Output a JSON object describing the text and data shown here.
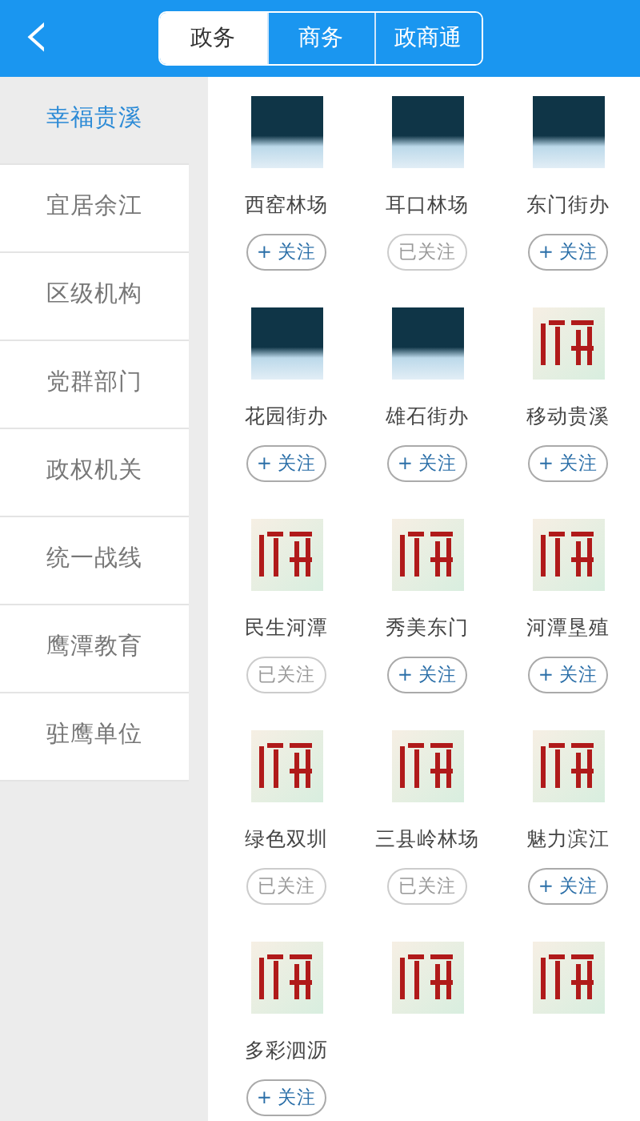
{
  "header": {
    "back_icon": "‹",
    "tabs": [
      {
        "label": "政务",
        "selected": true
      },
      {
        "label": "商务",
        "selected": false
      },
      {
        "label": "政商通",
        "selected": false
      }
    ]
  },
  "sidebar": {
    "items": [
      {
        "label": "幸福贵溪",
        "selected": true
      },
      {
        "label": "宜居余江",
        "selected": false
      },
      {
        "label": "区级机构",
        "selected": false
      },
      {
        "label": "党群部门",
        "selected": false
      },
      {
        "label": "政权机关",
        "selected": false
      },
      {
        "label": "统一战线",
        "selected": false
      },
      {
        "label": "鹰潭教育",
        "selected": false
      },
      {
        "label": "驻鹰单位",
        "selected": false
      }
    ]
  },
  "accounts": [
    {
      "kind": "photo",
      "name": "西窑林场",
      "follow": {
        "label": "+ 关注",
        "followed": false
      }
    },
    {
      "kind": "photo",
      "name": "耳口林场",
      "follow": {
        "label": "已关注",
        "followed": true
      }
    },
    {
      "kind": "photo",
      "name": "东门街办",
      "follow": {
        "label": "+ 关注",
        "followed": false
      }
    },
    {
      "kind": "photo",
      "name": "花园街办",
      "follow": {
        "label": "+ 关注",
        "followed": false
      }
    },
    {
      "kind": "photo",
      "name": "雄石街办",
      "follow": {
        "label": "+ 关注",
        "followed": false
      }
    },
    {
      "kind": "logo",
      "name": "移动贵溪",
      "follow": {
        "label": "+ 关注",
        "followed": false
      }
    },
    {
      "kind": "logo",
      "name": "民生河潭",
      "follow": {
        "label": "已关注",
        "followed": true
      }
    },
    {
      "kind": "logo",
      "name": "秀美东门",
      "follow": {
        "label": "+ 关注",
        "followed": false
      }
    },
    {
      "kind": "logo",
      "name": "河潭垦殖",
      "follow": {
        "label": "+ 关注",
        "followed": false
      }
    },
    {
      "kind": "logo",
      "name": "绿色双圳",
      "follow": {
        "label": "已关注",
        "followed": true
      }
    },
    {
      "kind": "logo",
      "name": "三县岭林场",
      "follow": {
        "label": "已关注",
        "followed": true
      }
    },
    {
      "kind": "logo",
      "name": "魅力滨江",
      "follow": {
        "label": "+ 关注",
        "followed": false
      }
    },
    {
      "kind": "logo",
      "name": "多彩泗沥",
      "follow": {
        "label": "+ 关注",
        "followed": false
      }
    },
    {
      "kind": "logo"
    },
    {
      "kind": "logo"
    }
  ]
}
